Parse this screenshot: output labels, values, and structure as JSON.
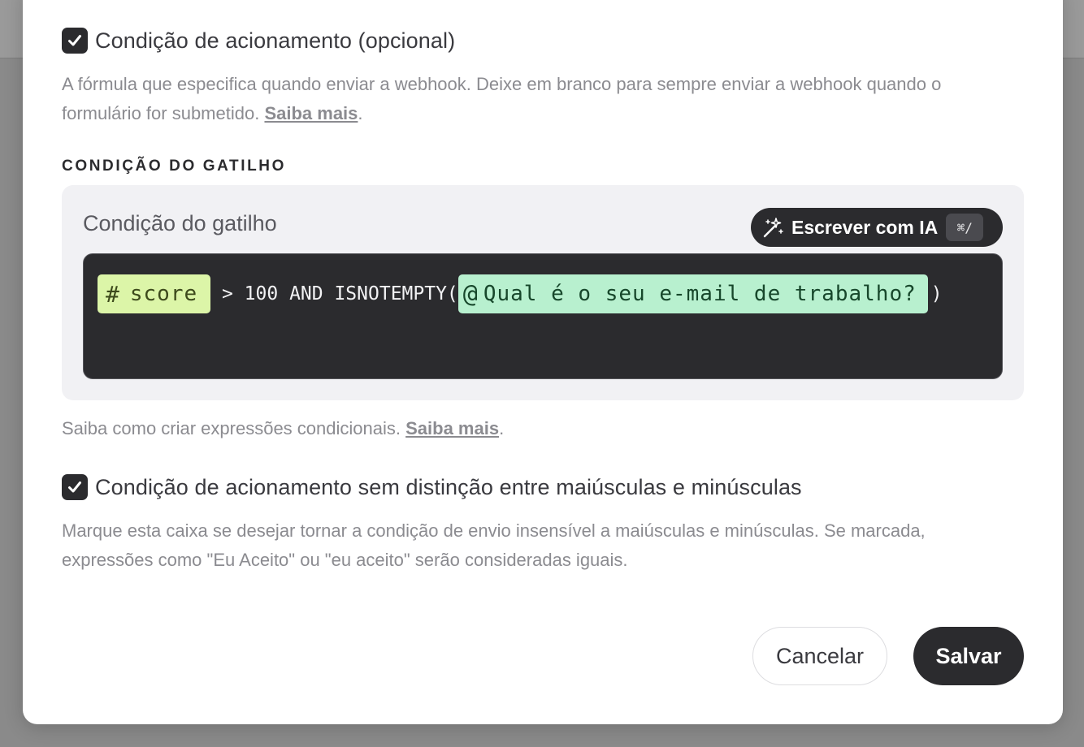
{
  "trigger_enabled": {
    "checked": true,
    "title": "Condição de acionamento (opcional)",
    "description": "A fórmula que especifica quando enviar a webhook. Deixe em branco para sempre enviar a webhook quando o formulário for submetido.",
    "link": "Saiba mais",
    "after_link": "."
  },
  "section_label": "CONDIÇÃO DO GATILHO",
  "condition_panel": {
    "title": "Condição do gatilho",
    "ai_button_label": "Escrever com IA",
    "ai_shortcut": "⌘/",
    "expression": {
      "field_token_symbol": "#",
      "field_token": "score",
      "operator_text": " > 100 AND ISNOTEMPTY(",
      "ref_token_symbol": "@",
      "ref_token": "Qual é o seu e-mail de trabalho?",
      "closing": ")"
    }
  },
  "help": {
    "text": "Saiba como criar expressões condicionais.",
    "link": "Saiba mais",
    "after_link": "."
  },
  "case_insensitive": {
    "checked": true,
    "title": "Condição de acionamento sem distinção entre maiúsculas e minúsculas",
    "description": "Marque esta caixa se desejar tornar a condição de envio insensível a maiúsculas e minúsculas. Se marcada, expressões como \"Eu Aceito\" ou \"eu aceito\" serão consideradas iguais."
  },
  "actions": {
    "cancel_label": "Cancelar",
    "save_label": "Salvar"
  },
  "colors": {
    "primary_dark": "#2b2b2e",
    "field_token_bg": "#dcf5a8",
    "ref_token_bg": "#b8f0cf",
    "panel_bg": "#f1f1f4"
  }
}
